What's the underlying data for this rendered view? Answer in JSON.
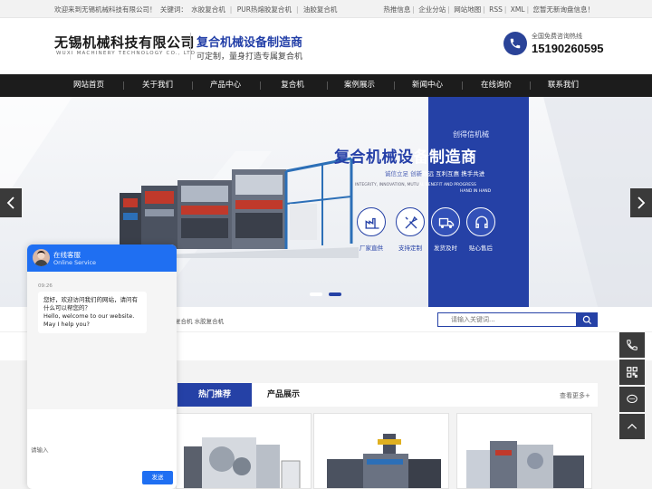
{
  "topbar": {
    "welcome": "欢迎来到无锡机械科技有限公司！",
    "keywords_label": "关键词：",
    "keywords": [
      "水胶复合机",
      "PUR热熔胶复合机",
      "油胶复合机"
    ],
    "links": [
      "热推信息",
      "企业分站",
      "网站地图",
      "RSS",
      "XML",
      "您暂无新询盘信息！"
    ]
  },
  "header": {
    "logo_cn": "无锡机械科技有限公司",
    "logo_en": "WUXI MACHINERY TECHNOLOGY CO., LTD",
    "slogan_main": "复合机械设备制造商",
    "slogan_sub": "可定制，量身打造专属复合机",
    "hotline_label": "全国免费咨询热线",
    "hotline_number": "15190260595"
  },
  "nav": [
    "网站首页",
    "关于我们",
    "产品中心",
    "复合机",
    "案例展示",
    "新闻中心",
    "在线询价",
    "联系我们"
  ],
  "banner": {
    "subtitle": "创得信机械",
    "title_part1": "复合机械设",
    "title_part2": "备制造商",
    "values_part1": "诚信立足  创新",
    "values_part2": "致远  互利互惠  携手共进",
    "english_part1": "INTEGRITY, INNOVATION, MUTU",
    "english_part2": "AL BENEFIT AND PROGRESS",
    "english_line2": "HAND IN HAND",
    "features": [
      "厂家直供",
      "支持定制",
      "发货及时",
      "贴心售后"
    ]
  },
  "search": {
    "hotwords": "复合机   水胶复合机",
    "placeholder": "请输入关键词..."
  },
  "products": {
    "tab_hot": "热门推荐",
    "tab_products": "产品展示",
    "more": "查看更多+"
  },
  "chat": {
    "title": "在线客服",
    "subtitle": "Online Service",
    "time": "09:26",
    "message": "您好，欢迎访问我们的网站，请问有什么可以帮您的？\nHello, welcome to our website. May I help you?",
    "input_label": "请输入",
    "send": "发送"
  },
  "colors": {
    "brand_blue": "#2541a6",
    "chat_blue": "#1f6ff2",
    "nav_bg": "#1c1c1c"
  },
  "side_icons": [
    "phone-icon",
    "qrcode-icon",
    "wechat-icon",
    "back-to-top-icon"
  ]
}
